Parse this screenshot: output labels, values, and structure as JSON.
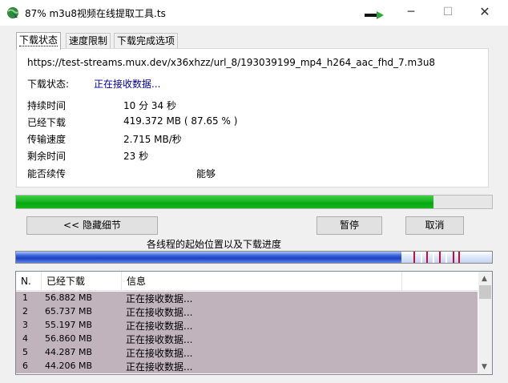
{
  "window": {
    "title": "87% m3u8视频在线提取工具.ts",
    "min_icon": "─",
    "max_icon": "☐",
    "close_icon": "✕"
  },
  "tabs": [
    {
      "label": "下载状态"
    },
    {
      "label": "速度限制"
    },
    {
      "label": "下载完成选项"
    }
  ],
  "status_panel": {
    "url": "https://test-streams.mux.dev/x36xhzz/url_8/193039199_mp4_h264_aac_fhd_7.m3u8",
    "status_label": "下载状态:",
    "status_value": "正在接收数据...",
    "rows": [
      {
        "label": "持续时间",
        "value": "10 分 34 秒"
      },
      {
        "label": "已经下载",
        "value": "419.372  MB  ( 87.65 % )"
      },
      {
        "label": "传输速度",
        "value": "2.715  MB/秒"
      },
      {
        "label": "剩余时间",
        "value": "23 秒"
      },
      {
        "label": "能否续传",
        "value": "能够"
      }
    ]
  },
  "progress": {
    "fraction": 0.8765
  },
  "buttons": {
    "hide_details": "<< 隐藏细节",
    "pause": "暂停",
    "cancel": "取消"
  },
  "threads_caption": "各线程的起始位置以及下载进度",
  "thread_bar": {
    "filled_fraction": 0.81
  },
  "thread_table": {
    "headers": [
      "N.",
      "已经下载",
      "信息",
      ""
    ],
    "rows": [
      {
        "n": "1",
        "downloaded": "56.882  MB",
        "info": "正在接收数据..."
      },
      {
        "n": "2",
        "downloaded": "65.737  MB",
        "info": "正在接收数据..."
      },
      {
        "n": "3",
        "downloaded": "55.197  MB",
        "info": "正在接收数据..."
      },
      {
        "n": "4",
        "downloaded": "56.860  MB",
        "info": "正在接收数据..."
      },
      {
        "n": "5",
        "downloaded": "44.287  MB",
        "info": "正在接收数据..."
      },
      {
        "n": "6",
        "downloaded": "44.206  MB",
        "info": "正在接收数据..."
      }
    ],
    "scroll_up_icon": "▲",
    "scroll_down_icon": "▼"
  },
  "colors": {
    "progress_green": "#06a80f",
    "thread_bar_blue": "#1d3fc3",
    "row_highlight": "#c0b3bc",
    "status_blue": "#0000a0"
  }
}
